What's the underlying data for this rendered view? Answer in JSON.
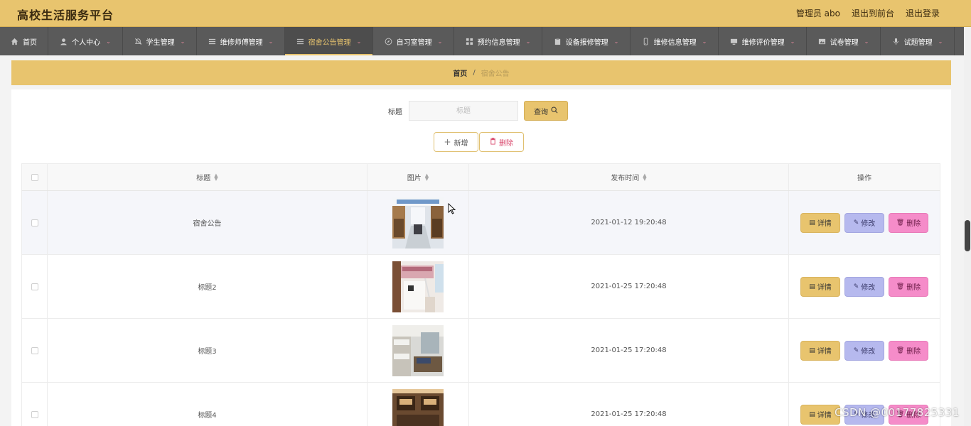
{
  "header": {
    "title": "高校生活服务平台",
    "admin_label": "管理员 abo",
    "back_to_front": "退出到前台",
    "logout": "退出登录"
  },
  "nav": [
    {
      "label": "首页",
      "icon": "home-icon",
      "has_menu": false,
      "active": false
    },
    {
      "label": "个人中心",
      "icon": "user-icon",
      "has_menu": true,
      "active": false
    },
    {
      "label": "学生管理",
      "icon": "bell-off-icon",
      "has_menu": true,
      "active": false
    },
    {
      "label": "维修师傅管理",
      "icon": "list-icon",
      "has_menu": true,
      "active": false
    },
    {
      "label": "宿舍公告管理",
      "icon": "list-icon",
      "has_menu": true,
      "active": true
    },
    {
      "label": "自习室管理",
      "icon": "compass-icon",
      "has_menu": true,
      "active": false
    },
    {
      "label": "预约信息管理",
      "icon": "grid-icon",
      "has_menu": true,
      "active": false
    },
    {
      "label": "设备报修管理",
      "icon": "clipboard-icon",
      "has_menu": true,
      "active": false
    },
    {
      "label": "维修信息管理",
      "icon": "phone-icon",
      "has_menu": true,
      "active": false
    },
    {
      "label": "维修评价管理",
      "icon": "monitor-icon",
      "has_menu": true,
      "active": false
    },
    {
      "label": "试卷管理",
      "icon": "picture-icon",
      "has_menu": true,
      "active": false
    },
    {
      "label": "试题管理",
      "icon": "microphone-icon",
      "has_menu": true,
      "active": false
    }
  ],
  "breadcrumb": {
    "home": "首页",
    "separator": "/",
    "current": "宿舍公告"
  },
  "search": {
    "label": "标题",
    "placeholder": "标题",
    "button": "查询"
  },
  "actions": {
    "add": "新增",
    "delete": "删除"
  },
  "table": {
    "columns": [
      "标题",
      "图片",
      "发布时间",
      "操作"
    ],
    "rows": [
      {
        "title": "宿舍公告",
        "time": "2021-01-12 19:20:48",
        "image": "dorm-photo-1"
      },
      {
        "title": "标题2",
        "time": "2021-01-25 17:20:48",
        "image": "dorm-photo-2"
      },
      {
        "title": "标题3",
        "time": "2021-01-25 17:20:48",
        "image": "dorm-photo-3"
      },
      {
        "title": "标题4",
        "time": "2021-01-25 17:20:48",
        "image": "dorm-photo-4"
      }
    ],
    "row_buttons": {
      "detail": "详情",
      "edit": "修改",
      "delete": "删除"
    }
  },
  "watermark": "CSDN @00177825331",
  "colors": {
    "accent": "#e8c46e",
    "nav_bg": "#5a5a5a",
    "edit_btn": "#b6b9ee",
    "delete_btn": "#f58cc9"
  }
}
